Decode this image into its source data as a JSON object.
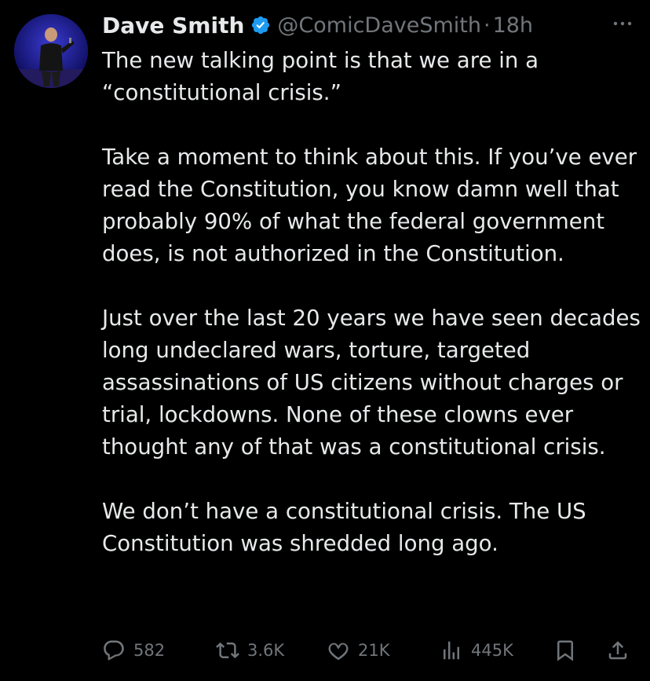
{
  "author": {
    "name": "Dave Smith",
    "handle": "@ComicDaveSmith",
    "separator": "·",
    "time": "18h",
    "verified_icon": "verified-badge-icon",
    "avatar": "avatar"
  },
  "tweet": {
    "paragraphs": [
      "The new talking point is that we are in a “constitutional crisis.”",
      "Take a moment to think about this. If you’ve ever read the Constitution, you know damn well that probably 90% of what the federal government does, is not authorized in the Constitution.",
      "Just over the last 20 years we have seen decades long undeclared wars, torture, targeted assassinations of US citizens without charges or trial, lockdowns. None of these clowns ever thought any of that was a constitutional crisis.",
      "We don’t have a constitutional crisis. The US Constitution was shredded long ago."
    ]
  },
  "actions": {
    "replies": "582",
    "reposts": "3.6K",
    "likes": "21K",
    "views": "445K"
  },
  "colors": {
    "background": "#000000",
    "text": "#e7e9ea",
    "muted": "#71767b",
    "verified": "#1d9bf0"
  }
}
